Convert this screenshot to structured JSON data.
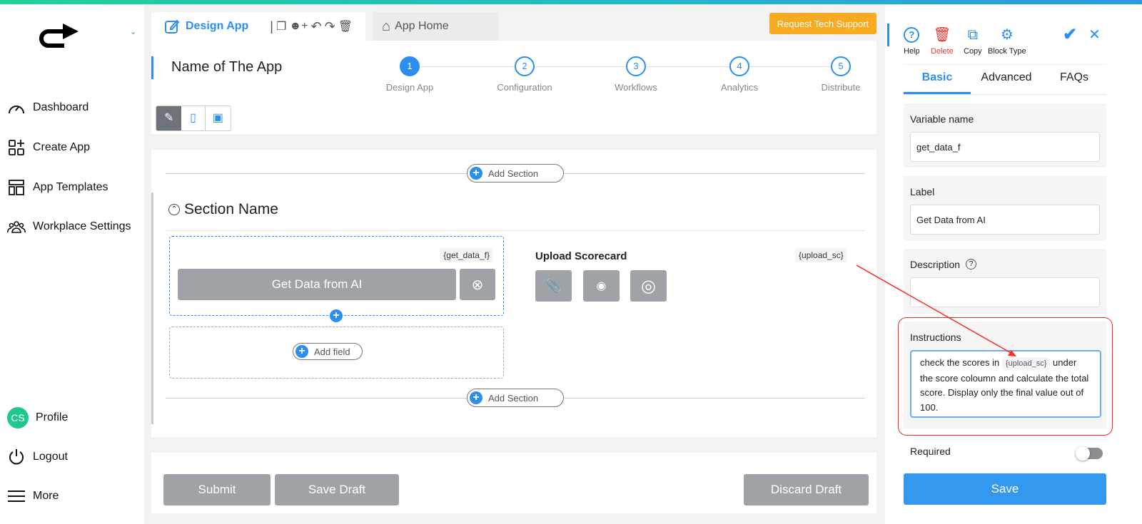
{
  "sidebar": {
    "items": [
      {
        "label": "Dashboard",
        "icon": "gauge-icon"
      },
      {
        "label": "Create App",
        "icon": "grid-plus-icon"
      },
      {
        "label": "App Templates",
        "icon": "layout-icon"
      },
      {
        "label": "Workplace Settings",
        "icon": "users-icon"
      }
    ],
    "profile": {
      "initials": "CS",
      "label": "Profile"
    },
    "logout": "Logout",
    "more": "More"
  },
  "tabs": {
    "design": "Design App",
    "home": "App Home"
  },
  "support_button": "Request Tech Support",
  "app_name": "Name of The App",
  "steps": [
    {
      "n": "1",
      "label": "Design App",
      "active": true
    },
    {
      "n": "2",
      "label": "Configuration"
    },
    {
      "n": "3",
      "label": "Workflows"
    },
    {
      "n": "4",
      "label": "Analytics"
    },
    {
      "n": "5",
      "label": "Distribute"
    }
  ],
  "canvas": {
    "add_section": "Add Section",
    "section_name": "Section Name",
    "field_var": "{get_data_f}",
    "field_button": "Get Data from AI",
    "add_field": "Add field",
    "upload_label": "Upload Scorecard",
    "upload_var": "{upload_sc}"
  },
  "footer": {
    "submit": "Submit",
    "save_draft": "Save Draft",
    "discard": "Discard Draft"
  },
  "panel": {
    "help": "Help",
    "delete": "Delete",
    "copy": "Copy",
    "block_type": "Block Type",
    "tabs": [
      "Basic",
      "Advanced",
      "FAQs"
    ],
    "variable_name_label": "Variable name",
    "variable_name": "get_data_f",
    "label_label": "Label",
    "label_value": "Get Data from AI",
    "description_label": "Description",
    "description_value": "",
    "instructions_label": "Instructions",
    "instructions": {
      "pre": "check the scores in",
      "chip": "{upload_sc}",
      "post": "under the score coloumn and calculate the total score. Display only the final value out of 100."
    },
    "required_label": "Required",
    "required": false,
    "save": "Save"
  },
  "colors": {
    "accent": "#2c8ff0",
    "support": "#f8ab21",
    "delete": "#e53935",
    "annotation": "#ff2a1a"
  }
}
